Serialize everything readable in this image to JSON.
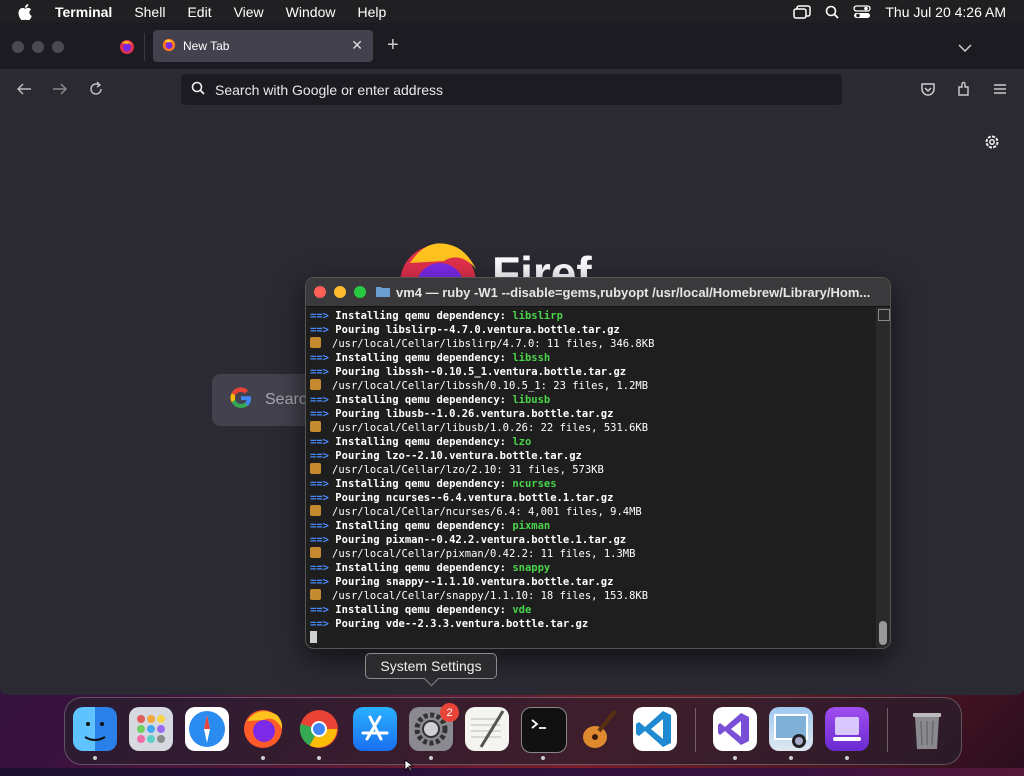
{
  "menubar": {
    "app_name": "Terminal",
    "items": [
      "Shell",
      "Edit",
      "View",
      "Window",
      "Help"
    ],
    "clock": "Thu Jul 20  4:26 AM"
  },
  "firefox": {
    "tab_title": "New Tab",
    "url_placeholder": "Search with Google or enter address",
    "logo_text": "Firef",
    "search_placeholder": "Searc"
  },
  "terminal": {
    "title": "vm4 — ruby -W1 --disable=gems,rubyopt /usr/local/Homebrew/Library/Hom...",
    "lines": [
      {
        "kind": "install",
        "text": "Installing qemu dependency: ",
        "pkg": "libslirp"
      },
      {
        "kind": "pour",
        "text": "Pouring libslirp--4.7.0.ventura.bottle.tar.gz"
      },
      {
        "kind": "cellar",
        "text": "/usr/local/Cellar/libslirp/4.7.0: 11 files, 346.8KB"
      },
      {
        "kind": "install",
        "text": "Installing qemu dependency: ",
        "pkg": "libssh"
      },
      {
        "kind": "pour",
        "text": "Pouring libssh--0.10.5_1.ventura.bottle.tar.gz"
      },
      {
        "kind": "cellar",
        "text": "/usr/local/Cellar/libssh/0.10.5_1: 23 files, 1.2MB"
      },
      {
        "kind": "install",
        "text": "Installing qemu dependency: ",
        "pkg": "libusb"
      },
      {
        "kind": "pour",
        "text": "Pouring libusb--1.0.26.ventura.bottle.tar.gz"
      },
      {
        "kind": "cellar",
        "text": "/usr/local/Cellar/libusb/1.0.26: 22 files, 531.6KB"
      },
      {
        "kind": "install",
        "text": "Installing qemu dependency: ",
        "pkg": "lzo"
      },
      {
        "kind": "pour",
        "text": "Pouring lzo--2.10.ventura.bottle.tar.gz"
      },
      {
        "kind": "cellar",
        "text": "/usr/local/Cellar/lzo/2.10: 31 files, 573KB"
      },
      {
        "kind": "install",
        "text": "Installing qemu dependency: ",
        "pkg": "ncurses"
      },
      {
        "kind": "pour",
        "text": "Pouring ncurses--6.4.ventura.bottle.1.tar.gz"
      },
      {
        "kind": "cellar",
        "text": "/usr/local/Cellar/ncurses/6.4: 4,001 files, 9.4MB"
      },
      {
        "kind": "install",
        "text": "Installing qemu dependency: ",
        "pkg": "pixman"
      },
      {
        "kind": "pour",
        "text": "Pouring pixman--0.42.2.ventura.bottle.1.tar.gz"
      },
      {
        "kind": "cellar",
        "text": "/usr/local/Cellar/pixman/0.42.2: 11 files, 1.3MB"
      },
      {
        "kind": "install",
        "text": "Installing qemu dependency: ",
        "pkg": "snappy"
      },
      {
        "kind": "pour",
        "text": "Pouring snappy--1.1.10.ventura.bottle.tar.gz"
      },
      {
        "kind": "cellar",
        "text": "/usr/local/Cellar/snappy/1.1.10: 18 files, 153.8KB"
      },
      {
        "kind": "install",
        "text": "Installing qemu dependency: ",
        "pkg": "vde"
      },
      {
        "kind": "pour",
        "text": "Pouring vde--2.3.3.ventura.bottle.tar.gz"
      }
    ],
    "arrow": "==>"
  },
  "tooltip": "System Settings",
  "dock": {
    "settings_badge": "2",
    "apps": [
      "finder",
      "launchpad",
      "safari",
      "firefox",
      "chrome",
      "app-store",
      "system-settings",
      "textedit",
      "terminal",
      "garageband",
      "vscode",
      "visual-studio",
      "preview",
      "utm",
      "trash"
    ]
  },
  "colors": {
    "accent_arrow": "#4a8cff",
    "package_green": "#4bd34b",
    "terminal_bg": "#1e1e1e",
    "firefox_bg": "#2b2a33",
    "badge_red": "#e8443a"
  }
}
